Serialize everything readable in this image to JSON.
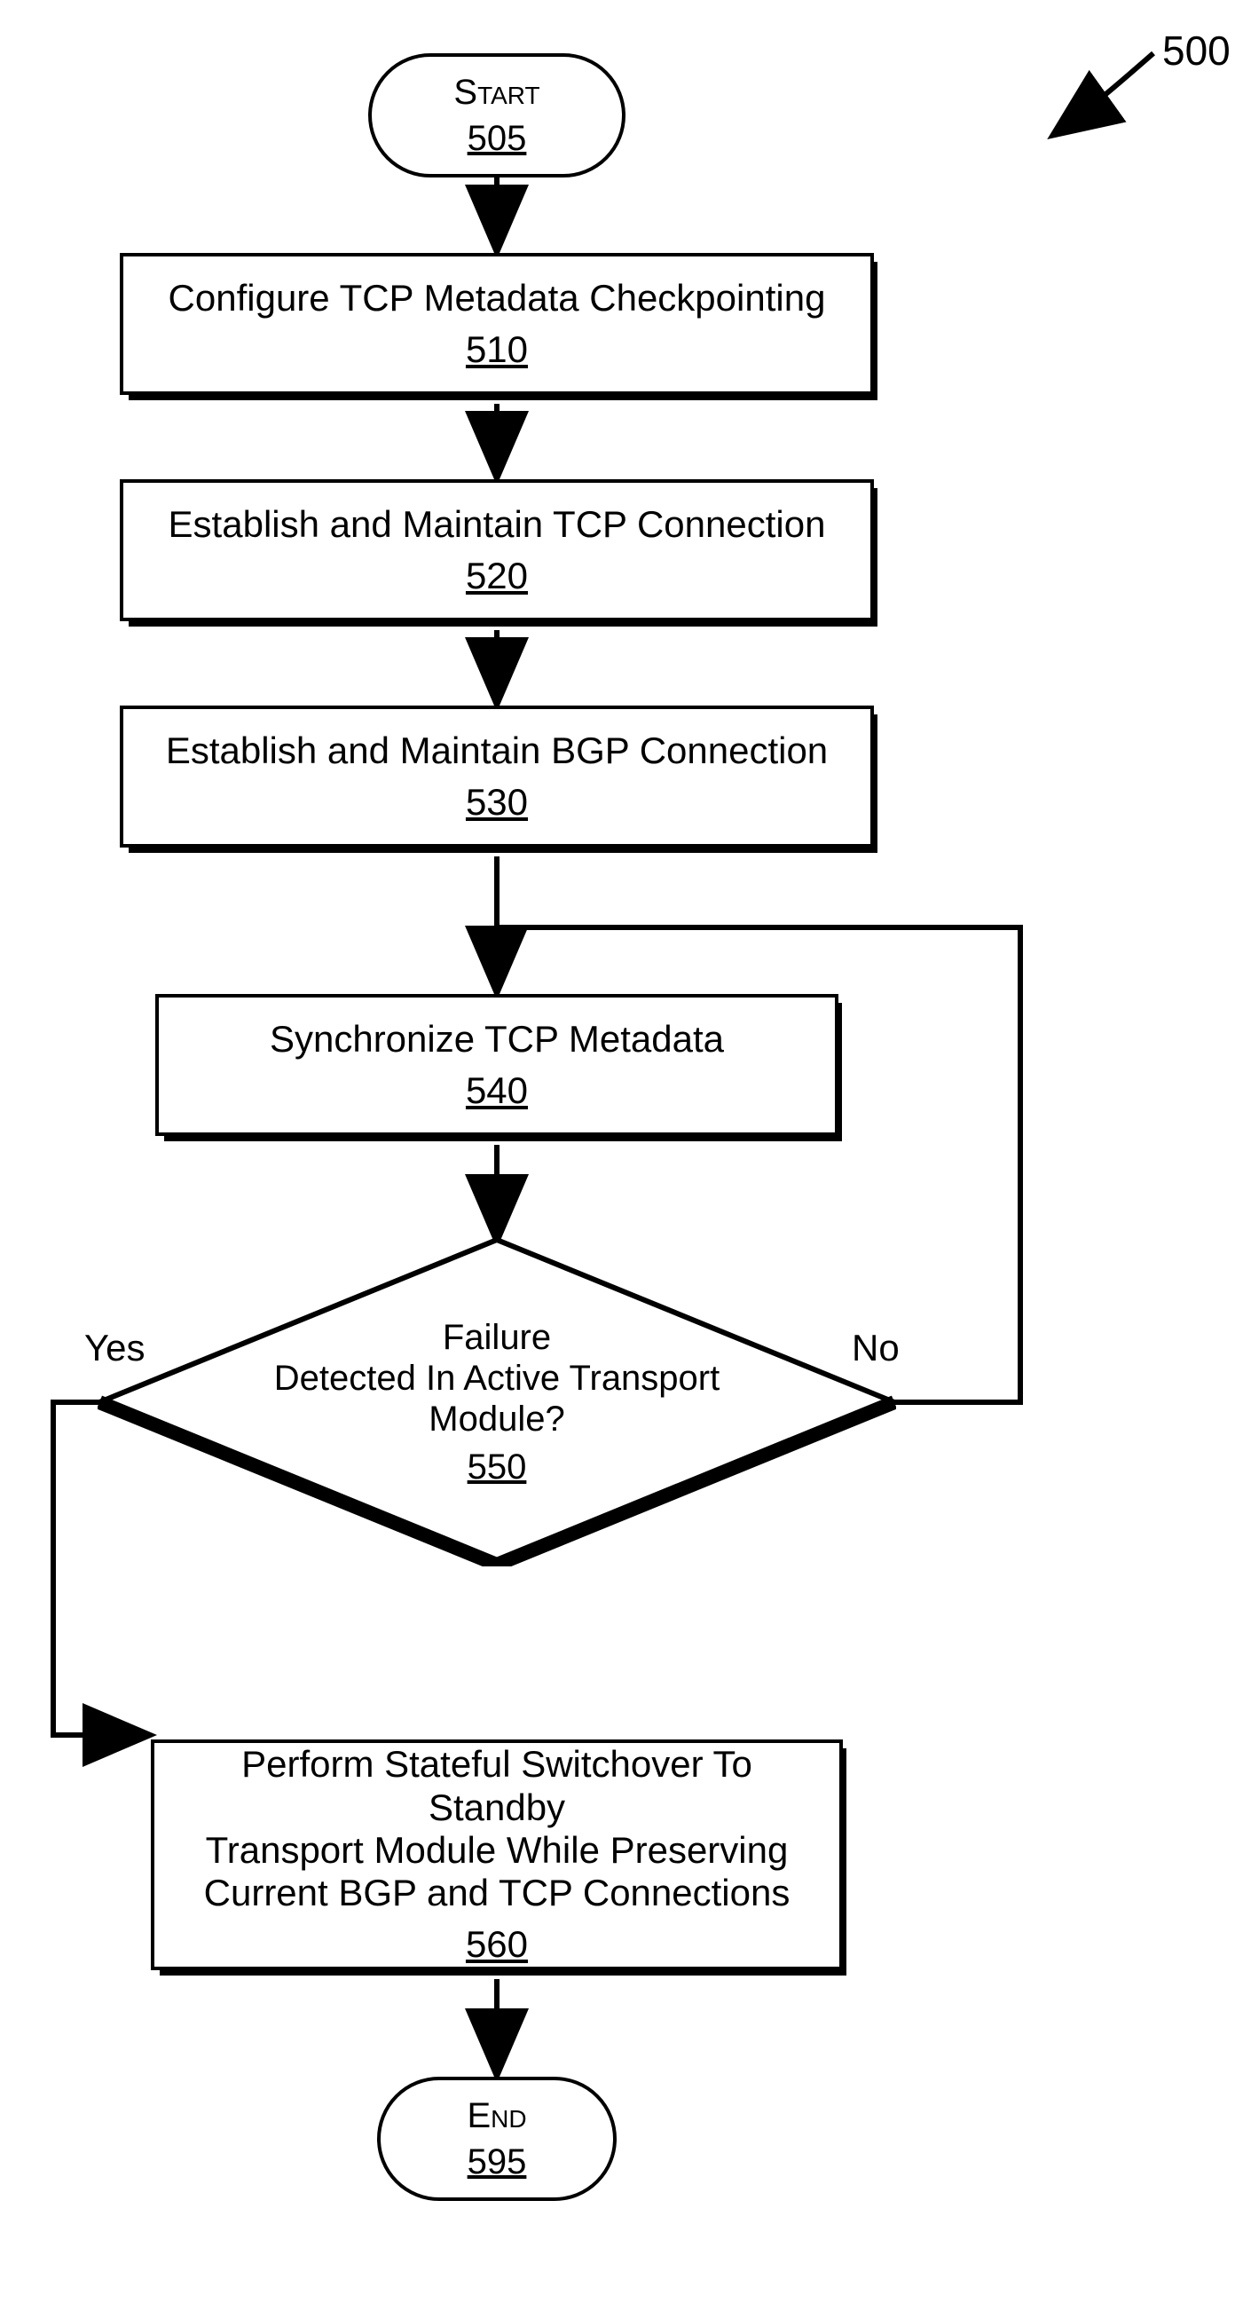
{
  "figure_number": "500",
  "nodes": {
    "start": {
      "label": "Start",
      "num": "505"
    },
    "n510": {
      "label": "Configure TCP Metadata Checkpointing",
      "num": "510"
    },
    "n520": {
      "label": "Establish and Maintain TCP Connection",
      "num": "520"
    },
    "n530": {
      "label": "Establish and Maintain BGP Connection",
      "num": "530"
    },
    "n540": {
      "label": "Synchronize TCP Metadata",
      "num": "540"
    },
    "decision": {
      "line1": "Failure",
      "line2": "Detected In Active Transport",
      "line3": "Module?",
      "num": "550"
    },
    "n560": {
      "line1": "Perform Stateful Switchover To Standby",
      "line2": "Transport Module While Preserving",
      "line3": "Current BGP and TCP Connections",
      "num": "560"
    },
    "end": {
      "label": "End",
      "num": "595"
    }
  },
  "edges": {
    "yes": "Yes",
    "no": "No"
  }
}
